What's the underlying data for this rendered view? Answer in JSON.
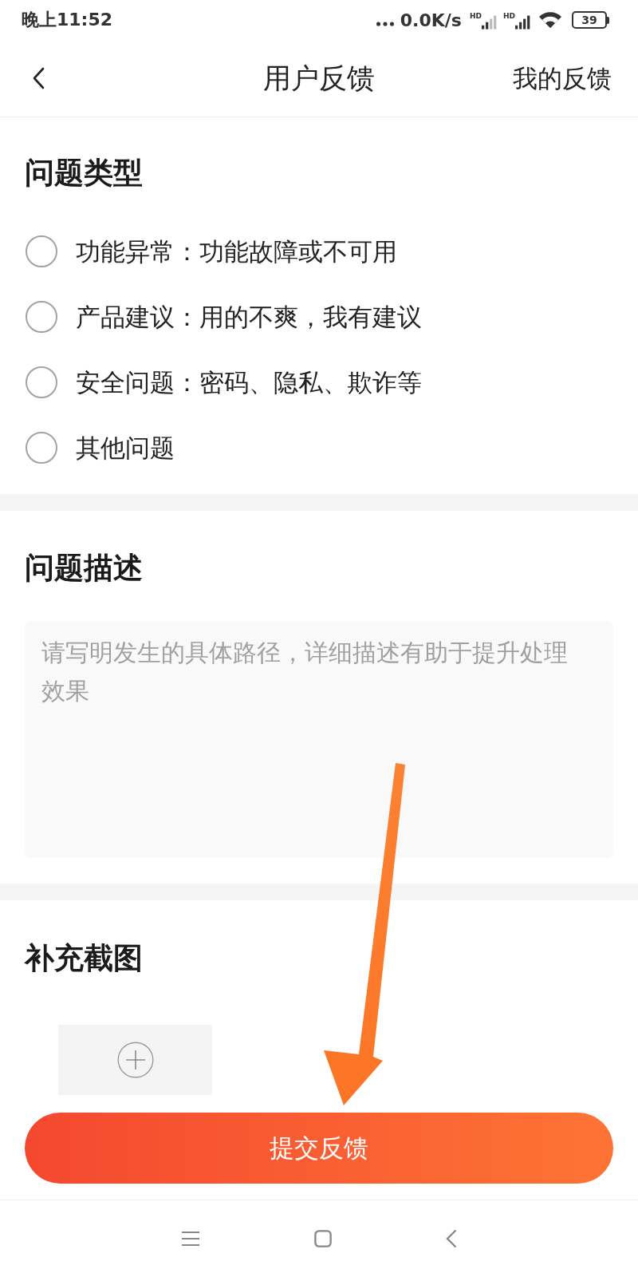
{
  "status_bar": {
    "time": "晚上11:52",
    "net_speed": "0.0K/s",
    "signals": [
      {
        "label": "HD",
        "kind": "weak"
      },
      {
        "label": "HD",
        "kind": "full"
      }
    ],
    "battery": "39"
  },
  "header": {
    "title": "用户反馈",
    "action": "我的反馈"
  },
  "issue_type": {
    "title": "问题类型",
    "options": [
      {
        "label": "功能异常：功能故障或不可用",
        "selected": false
      },
      {
        "label": "产品建议：用的不爽，我有建议",
        "selected": false
      },
      {
        "label": "安全问题：密码、隐私、欺诈等",
        "selected": false
      },
      {
        "label": "其他问题",
        "selected": false
      }
    ]
  },
  "description": {
    "title": "问题描述",
    "placeholder": "请写明发生的具体路径，详细描述有助于提升处理效果"
  },
  "screenshots": {
    "title": "补充截图"
  },
  "submit_button": "提交反馈"
}
